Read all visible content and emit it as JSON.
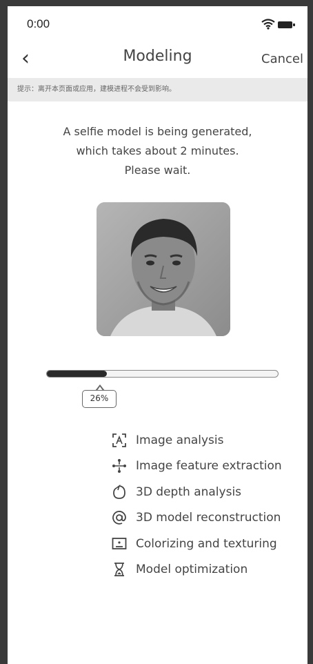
{
  "status_bar": {
    "time": "0:00"
  },
  "nav": {
    "title": "Modeling",
    "cancel_label": "Cancel",
    "back_icon": "chevron-left-icon"
  },
  "notice": {
    "text": "提示：离开本页面或应用，建模进程不会受到影响。"
  },
  "message": {
    "line1": "A selfie model is being generated,",
    "line2": "which takes about 2 minutes.",
    "line3": "Please wait."
  },
  "progress": {
    "value": 0.26,
    "label": "26%"
  },
  "steps": [
    {
      "label": "Image analysis",
      "icon": "scan-face-icon"
    },
    {
      "label": "Image feature extraction",
      "icon": "feature-nodes-icon"
    },
    {
      "label": "3D depth analysis",
      "icon": "depth-head-icon"
    },
    {
      "label": "3D model reconstruction",
      "icon": "at-sign-icon"
    },
    {
      "label": "Colorizing and texturing",
      "icon": "texture-frame-icon"
    },
    {
      "label": "Model optimization",
      "icon": "hourglass-icon"
    }
  ]
}
